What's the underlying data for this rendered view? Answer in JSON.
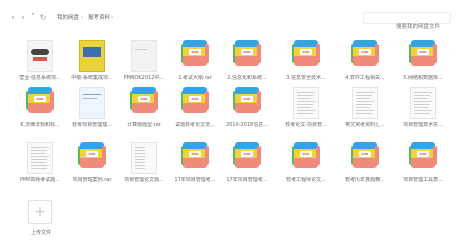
{
  "toolbar": {
    "back_icon": "chevron-left-icon",
    "forward_icon": "chevron-right-icon",
    "up_icon": "chevron-up-icon",
    "refresh_icon": "refresh-icon",
    "breadcrumb": [
      "我的网盘",
      "报考资料"
    ],
    "breadcrumb_separator": "›",
    "search_placeholder": "搜索我的网盘文件"
  },
  "files": [
    {
      "label": "营业-信息系统项...",
      "kind": "image-doc"
    },
    {
      "label": "中级-系统集成项...",
      "kind": "book-cover"
    },
    {
      "label": "PMBOK2012中...",
      "kind": "doc-white"
    },
    {
      "label": "1.考试大纲.rar",
      "kind": "rar"
    },
    {
      "label": "2.信息化和系统...",
      "kind": "rar"
    },
    {
      "label": "3.信息安全技术...",
      "kind": "rar"
    },
    {
      "label": "4.软件工程相关...",
      "kind": "rar"
    },
    {
      "label": "5.网络和数据库...",
      "kind": "rar"
    },
    {
      "label": "6.法律法规和标...",
      "kind": "rar"
    },
    {
      "label": "软考项目管理理...",
      "kind": "doc-blue"
    },
    {
      "label": "计算题题型.rar",
      "kind": "rar"
    },
    {
      "label": "试题软考论文范...",
      "kind": "rar"
    },
    {
      "label": "2010-2018信息...",
      "kind": "rar"
    },
    {
      "label": "软考论文-项目管...",
      "kind": "doc-text"
    },
    {
      "label": "英文常考资料汇...",
      "kind": "doc-text"
    },
    {
      "label": "项目管理技术实...",
      "kind": "doc-text"
    },
    {
      "label": "PMP高频考试题...",
      "kind": "doc-text"
    },
    {
      "label": "项目管理案例.rar",
      "kind": "rar"
    },
    {
      "label": "项目管理论文题...",
      "kind": "doc-lines"
    },
    {
      "label": "17年项目管理考...",
      "kind": "rar"
    },
    {
      "label": "17年项目管理考...",
      "kind": "rar"
    },
    {
      "label": "软考工程师论文...",
      "kind": "rar"
    },
    {
      "label": "软考历年真题精...",
      "kind": "rar"
    },
    {
      "label": "项目管理工具表...",
      "kind": "rar"
    }
  ],
  "upload": {
    "label": "上传文件",
    "icon": "plus-icon"
  },
  "colors": {
    "rar_blue": "#36a3e8",
    "rar_yellow": "#f0d23a",
    "rar_red": "#f08a7a",
    "rar_green": "#5bb95d",
    "book_yellow": "#e9d23c",
    "book_blue": "#3d6fb0"
  }
}
